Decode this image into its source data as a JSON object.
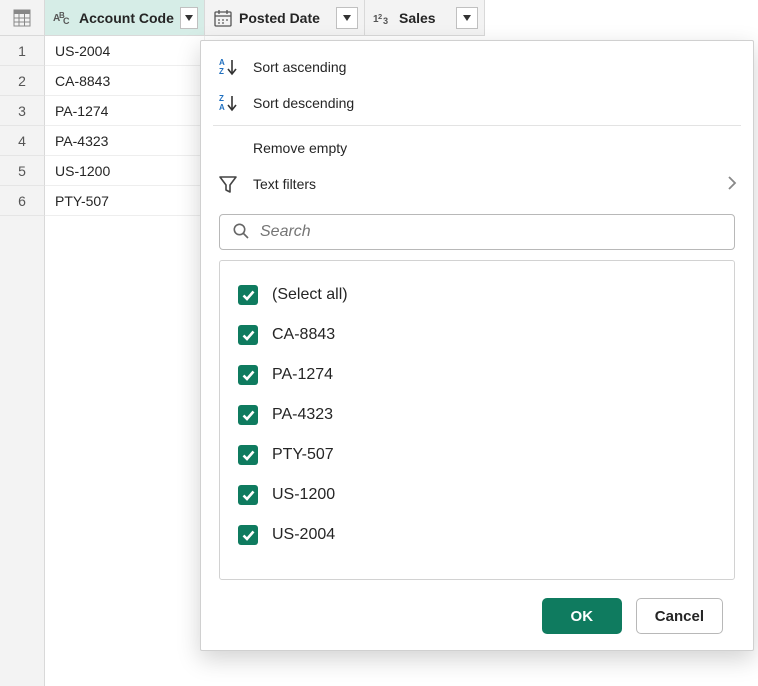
{
  "columns": {
    "account": {
      "label": "Account Code"
    },
    "posted": {
      "label": "Posted Date"
    },
    "sales": {
      "label": "Sales"
    }
  },
  "rows": [
    {
      "n": "1",
      "account": "US-2004"
    },
    {
      "n": "2",
      "account": "CA-8843"
    },
    {
      "n": "3",
      "account": "PA-1274"
    },
    {
      "n": "4",
      "account": "PA-4323"
    },
    {
      "n": "5",
      "account": "US-1200"
    },
    {
      "n": "6",
      "account": "PTY-507"
    }
  ],
  "menu": {
    "sort_asc": "Sort ascending",
    "sort_desc": "Sort descending",
    "remove_empty": "Remove empty",
    "text_filters": "Text filters"
  },
  "search": {
    "placeholder": "Search"
  },
  "filter_values": [
    {
      "label": "(Select all)",
      "checked": true
    },
    {
      "label": "CA-8843",
      "checked": true
    },
    {
      "label": "PA-1274",
      "checked": true
    },
    {
      "label": "PA-4323",
      "checked": true
    },
    {
      "label": "PTY-507",
      "checked": true
    },
    {
      "label": "US-1200",
      "checked": true
    },
    {
      "label": "US-2004",
      "checked": true
    }
  ],
  "buttons": {
    "ok": "OK",
    "cancel": "Cancel"
  }
}
